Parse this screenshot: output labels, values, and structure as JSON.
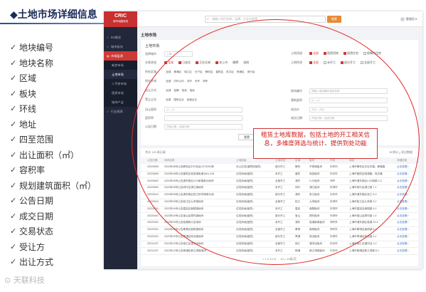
{
  "slide": {
    "title": "◆土地市场详细信息",
    "watermark": "⊙ 天联科技",
    "bullets": [
      "地块编号",
      "地块名称",
      "区域",
      "板块",
      "环线",
      "地址",
      "四至范围",
      "出让面积（㎡）",
      "容积率",
      "规划建筑面积（㎡）",
      "公告日期",
      "成交日期",
      "交易状态",
      "受让方",
      "出让方式"
    ]
  },
  "app": {
    "logo": {
      "main": "CRIC",
      "sub": "城市地图系统"
    },
    "nav": [
      {
        "label": "5G概述",
        "icon": "□"
      },
      {
        "label": "城市板块",
        "icon": "□"
      },
      {
        "label": "市场监测",
        "icon": "▤",
        "group": true
      },
      {
        "label": "新房市场",
        "sub": true
      },
      {
        "label": "土地市场",
        "sub": true,
        "active": true
      },
      {
        "label": "二手房市场",
        "sub": true
      },
      {
        "label": "租赁市场",
        "sub": true
      },
      {
        "label": "城市产业",
        "sub": true
      },
      {
        "label": "行业报表",
        "icon": "□"
      }
    ],
    "search": {
      "placeholder": "请输入项目名称、品牌、企业名称等",
      "button": "搜索"
    },
    "user": "管理员",
    "breadcrumb": "土地市场",
    "filter": {
      "section_title": "土地市场",
      "rows": [
        {
          "label": "选择城市",
          "options": [
            "上海"
          ]
        },
        {
          "label": "交易状态",
          "options": [
            "全部",
            "已成交",
            "正在交易",
            "未上市",
            "撤牌",
            "流拍",
            "暂停出让"
          ]
        },
        {
          "label": "所在区域",
          "options": [
            "全部",
            "黄浦区",
            "徐汇区",
            "长宁区",
            "静安区",
            "普陀区",
            "虹口区",
            "杨浦区",
            "闵行区"
          ]
        },
        {
          "label": "所在环线",
          "options": [
            "全部",
            "内环以内",
            "中环",
            "外环",
            "郊环"
          ]
        },
        {
          "label": "出让方式",
          "options": [
            "全部",
            "挂牌",
            "拍卖",
            "招标"
          ]
        },
        {
          "label": "受让企业",
          "options": [
            "全部",
            "国有企业",
            "民营企业"
          ]
        }
      ],
      "right_rows": [
        {
          "label": "土地用途",
          "options": [
            "全部",
            "租赁用地",
            "租赁住宅",
            "保障性住房",
            "其他"
          ]
        },
        {
          "label": "土地性质",
          "options": [
            "全部",
            "未开工",
            "部分开工",
            "全部开工"
          ]
        },
        {
          "label": "地块编号",
          "placeholder": "请输入地块编号/地块名称"
        },
        {
          "label": "建筑面积",
          "placeholder": "㎡ – ㎡"
        },
        {
          "label": "成交价",
          "placeholder": "万元 – 万元"
        },
        {
          "label": "成交日期",
          "placeholder": "开始日期 – 结束日期"
        }
      ],
      "left_fields": [
        {
          "label": "出让面积",
          "placeholder": "㎡ – ㎡"
        },
        {
          "label": "容积率",
          "placeholder": "– "
        },
        {
          "label": "楼面价",
          "placeholder": "元/㎡ – 元/㎡"
        },
        {
          "label": "公告日期",
          "placeholder": "开始日期 – 结束日期"
        }
      ],
      "reset": "重置",
      "query": "查询"
    },
    "callout": "租赁土地库数据，包括土地的开工相关信息，多维度筛选与统计、提供到处功能",
    "table": {
      "summary": "共计 123 条记录",
      "actions": "⊞ 统计  ⤓ 导出数据",
      "headers": [
        "公告日期",
        "地块名称",
        "土地用途",
        "土地状态",
        "区域",
        "板块",
        "环线",
        "地址",
        "详细信息"
      ],
      "rows": [
        [
          "20220805",
          "2022年08号公告静安区中兴社区C070202单元",
          "办公住宅(保障性租赁)",
          "部分开工",
          "静安",
          "不夜城板块",
          "内环内",
          "上海市静安区天目中路、秣陵路",
          "点击查看>"
        ],
        [
          "20220809",
          "2022年08号公告普陀区真如镇街道1801-01地块",
          "住宅用地(租赁)",
          "未开工",
          "普陀",
          "真如板块",
          "内中环",
          "上海市普陀区桃浦路、真光路",
          "点击查看>"
        ],
        [
          "20220602",
          "2022年06号公告浦东新区川沙新镇单元地块",
          "住宅用地(租赁)",
          "全部开工",
          "浦东",
          "川沙板块",
          "郊环",
          "上海市浦东新区川沙新镇 2-2",
          "点击查看>"
        ],
        [
          "20220602",
          "2022年06号公告闵行区浦江镇地块",
          "住宅用地(租赁)",
          "未开工",
          "闵行",
          "浦江板块",
          "外郊环",
          "上海市闵行区浦江镇 7-1",
          "点击查看>"
        ],
        [
          "20220512",
          "2022年05号公告浦东新区张江科学城单元地块",
          "住宅用地(租赁)",
          "部分开工",
          "浦东",
          "张江板块",
          "中外环",
          "上海市浦东新区张江 5-3",
          "点击查看>"
        ],
        [
          "20220512",
          "2022年05号公告松江区九亭镇地块",
          "住宅用地(租赁)",
          "全部开工",
          "松江",
          "九亭板块",
          "外郊环",
          "上海市松江区九亭镇 3-2",
          "点击查看>"
        ],
        [
          "20220401",
          "2022年04号公告嘉定区南翔镇地块",
          "住宅用地(租赁)",
          "未开工",
          "嘉定",
          "南翔板块",
          "外郊环",
          "上海市嘉定区南翔镇 9-2",
          "点击查看>"
        ],
        [
          "20220401",
          "2022年04号公告宝山区顾村镇地块",
          "住宅用地(租赁)",
          "部分开工",
          "宝山",
          "顾村板块",
          "外郊环",
          "上海市宝山区顾村镇 1-4",
          "点击查看>"
        ],
        [
          "20220301",
          "2022年03号公告临港新片区地块",
          "住宅用地(租赁)",
          "未开工",
          "浦东",
          "临港新城板块",
          "郊环外",
          "上海市浦东新区临港 10-3",
          "点击查看>"
        ],
        [
          "20220301",
          "2022年03号公告奉贤区南桥镇地块",
          "住宅用地(租赁)",
          "全部开工",
          "奉贤",
          "南桥板块",
          "郊环外",
          "上海市奉贤区南桥镇 6-2",
          "点击查看>"
        ],
        [
          "20220201",
          "2022年02号公告青浦区徐泾镇地块",
          "住宅用地(租赁)",
          "部分开工",
          "青浦",
          "徐泾板块",
          "外郊环",
          "上海市青浦区徐泾镇 4-1",
          "点击查看>"
        ],
        [
          "20211207",
          "2021年12号公告徐汇区漕河泾地块",
          "住宅用地(租赁)",
          "全部开工",
          "徐汇",
          "漕河泾板块",
          "内中环",
          "上海市徐汇区漕河泾 2-2",
          "点击查看>"
        ],
        [
          "20211207",
          "2021年12号公告杨浦区新江湾城地块",
          "住宅用地(租赁)",
          "未开工",
          "杨浦",
          "新江湾城板块",
          "中外环",
          "上海市杨浦区新江湾城 8-1",
          "点击查看>"
        ]
      ],
      "pager": "< 1 2 3 4 5 … 10 >  10条/页"
    }
  }
}
